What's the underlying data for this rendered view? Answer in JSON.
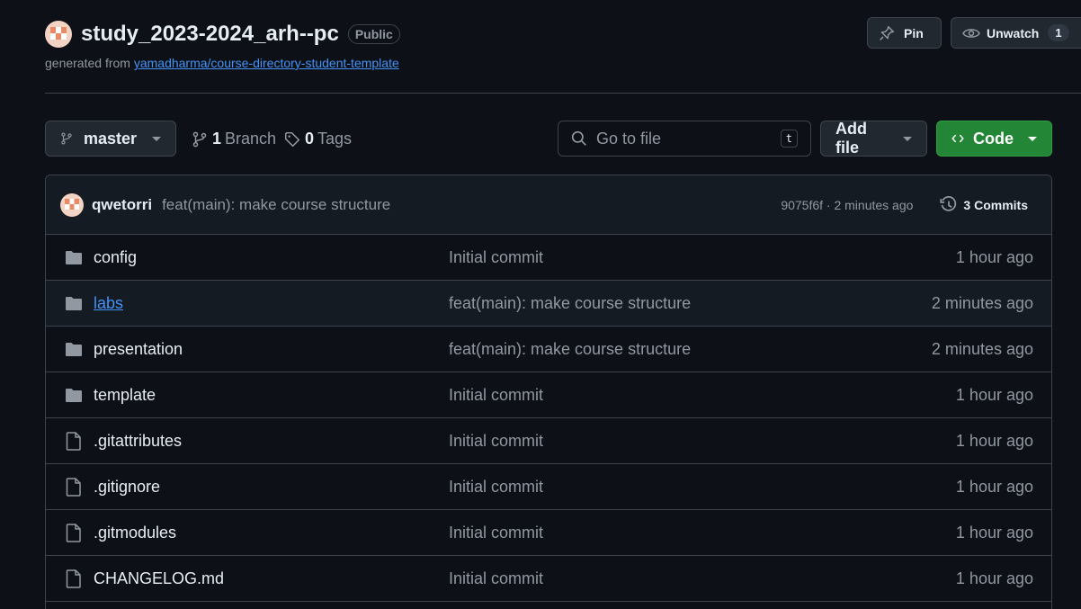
{
  "repo": {
    "name": "study_2023-2024_arh--pc",
    "visibility": "Public",
    "generated_prefix": "generated from",
    "template_link": "yamadharma/course-directory-student-template"
  },
  "actions": {
    "pin_label": "Pin",
    "watch_label": "Unwatch",
    "watch_count": "1"
  },
  "toolbar": {
    "branch": "master",
    "branch_count": "1",
    "branch_label": "Branch",
    "tag_count": "0",
    "tag_label": "Tags",
    "search_placeholder": "Go to file",
    "search_shortcut": "t",
    "add_file_label": "Add file",
    "code_label": "Code"
  },
  "latest_commit": {
    "author": "qwetorri",
    "message": "feat(main): make course structure",
    "meta": "9075f6f · 2 minutes ago",
    "commits_label": "3 Commits"
  },
  "files": [
    {
      "type": "folder",
      "name": "config",
      "message": "Initial commit",
      "age": "1 hour ago"
    },
    {
      "type": "folder",
      "name": "labs",
      "message": "feat(main): make course structure",
      "age": "2 minutes ago"
    },
    {
      "type": "folder",
      "name": "presentation",
      "message": "feat(main): make course structure",
      "age": "2 minutes ago"
    },
    {
      "type": "folder",
      "name": "template",
      "message": "Initial commit",
      "age": "1 hour ago"
    },
    {
      "type": "file",
      "name": ".gitattributes",
      "message": "Initial commit",
      "age": "1 hour ago"
    },
    {
      "type": "file",
      "name": ".gitignore",
      "message": "Initial commit",
      "age": "1 hour ago"
    },
    {
      "type": "file",
      "name": ".gitmodules",
      "message": "Initial commit",
      "age": "1 hour ago"
    },
    {
      "type": "file",
      "name": "CHANGELOG.md",
      "message": "Initial commit",
      "age": "1 hour ago"
    }
  ],
  "colors": {
    "background": "#0d1117",
    "accent_link": "#4493f8",
    "code_button": "#238636"
  }
}
